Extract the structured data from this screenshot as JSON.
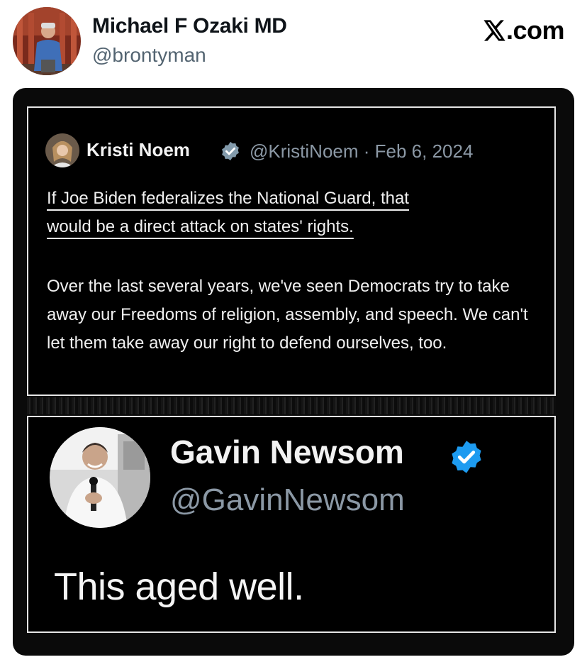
{
  "post": {
    "author_name": "Michael F Ozaki MD",
    "author_handle": "@brontyman",
    "brand": ".com",
    "brand_icon": "x-logo-icon"
  },
  "image": {
    "quoted_tweet": {
      "name": "Kristi Noem",
      "meta": "@KristiNoem · Feb 6, 2024",
      "line1": "If Joe Biden federalizes the National Guard, that",
      "line2": "would be a direct attack on states' rights.",
      "paragraph2": "Over the last several years, we've seen Democrats try to take away our Freedoms of religion, assembly, and speech. We can't let them take away our right to defend ourselves, too."
    },
    "reply_tweet": {
      "name": "Gavin Newsom",
      "handle": "@GavinNewsom",
      "text": "This aged well."
    },
    "colors": {
      "verified_gray": "#829aab",
      "verified_blue": "#1d9bf0",
      "panel_border": "#e6e6e6"
    }
  }
}
